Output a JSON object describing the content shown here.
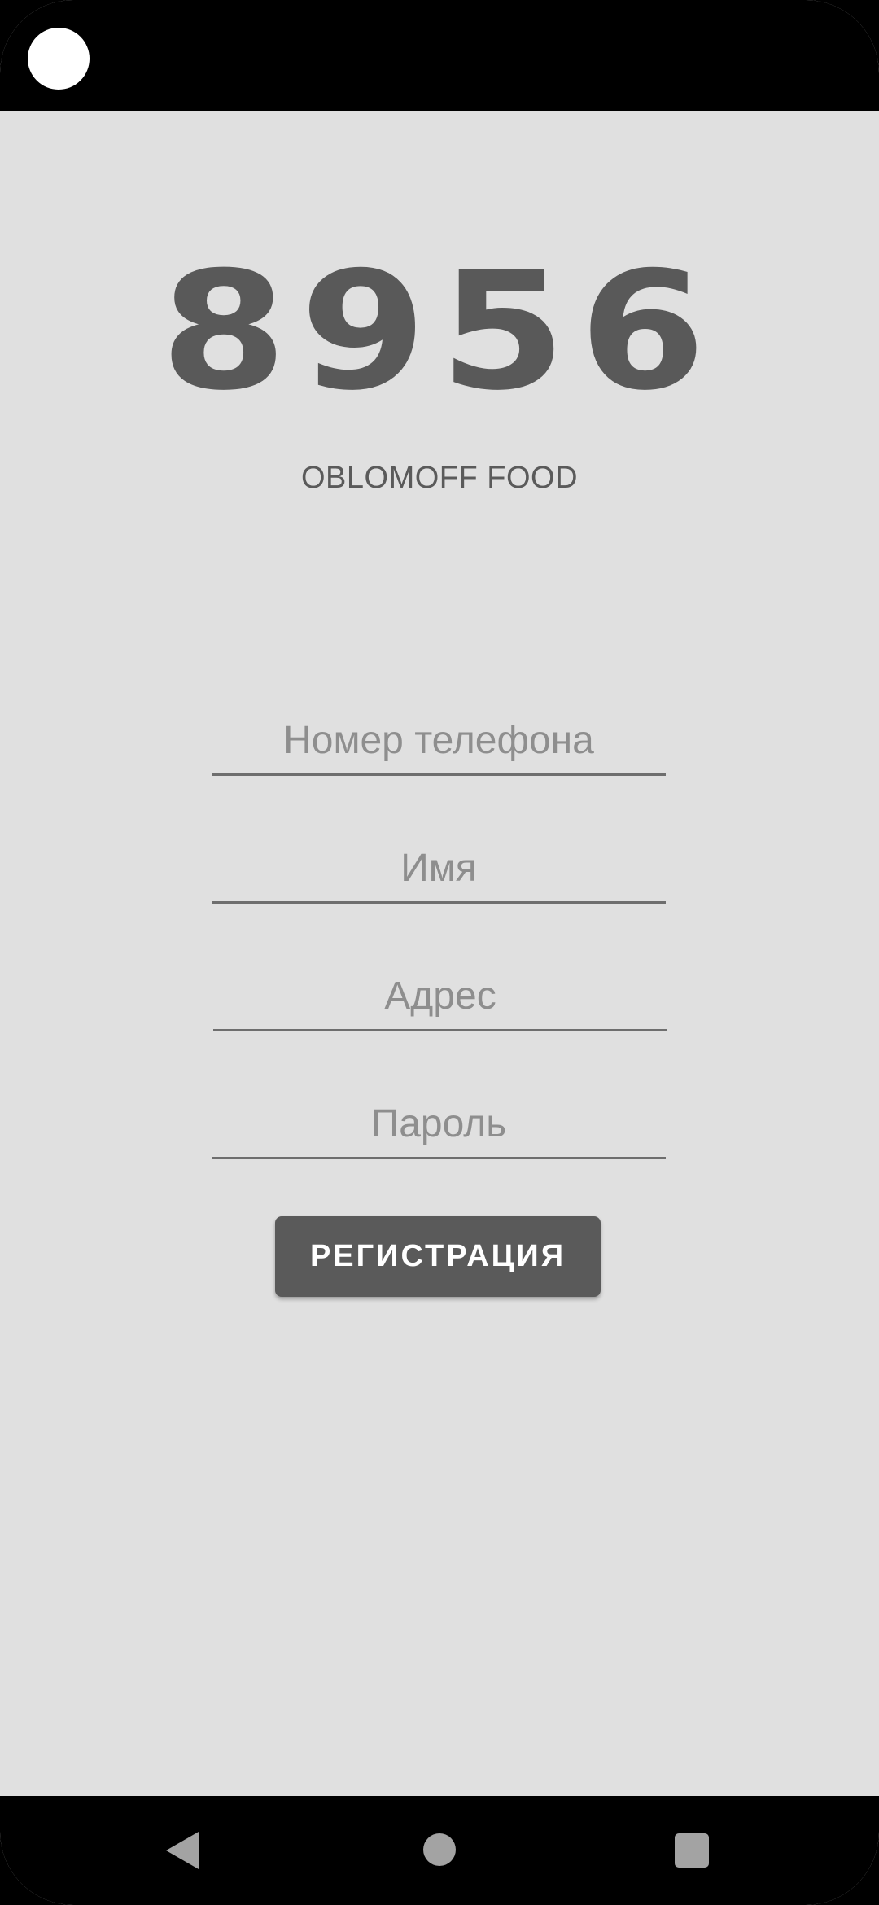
{
  "app": {
    "logo_text": "8956",
    "brand_name": "OBLOMOFF FOOD"
  },
  "form": {
    "phone": {
      "placeholder": "Номер телефона",
      "value": ""
    },
    "name": {
      "placeholder": "Имя",
      "value": ""
    },
    "address": {
      "placeholder": "Адрес",
      "value": ""
    },
    "password": {
      "placeholder": "Пароль",
      "value": ""
    },
    "register_label": "РЕГИСТРАЦИЯ"
  },
  "icons": {
    "camera": "camera-cutout-icon",
    "back": "back-triangle-icon",
    "home": "home-circle-icon",
    "recents": "recents-square-icon"
  },
  "colors": {
    "background": "#e0e0e0",
    "accent": "#5a5a5a",
    "system_bars": "#000000",
    "placeholder": "#8e8e8e"
  }
}
